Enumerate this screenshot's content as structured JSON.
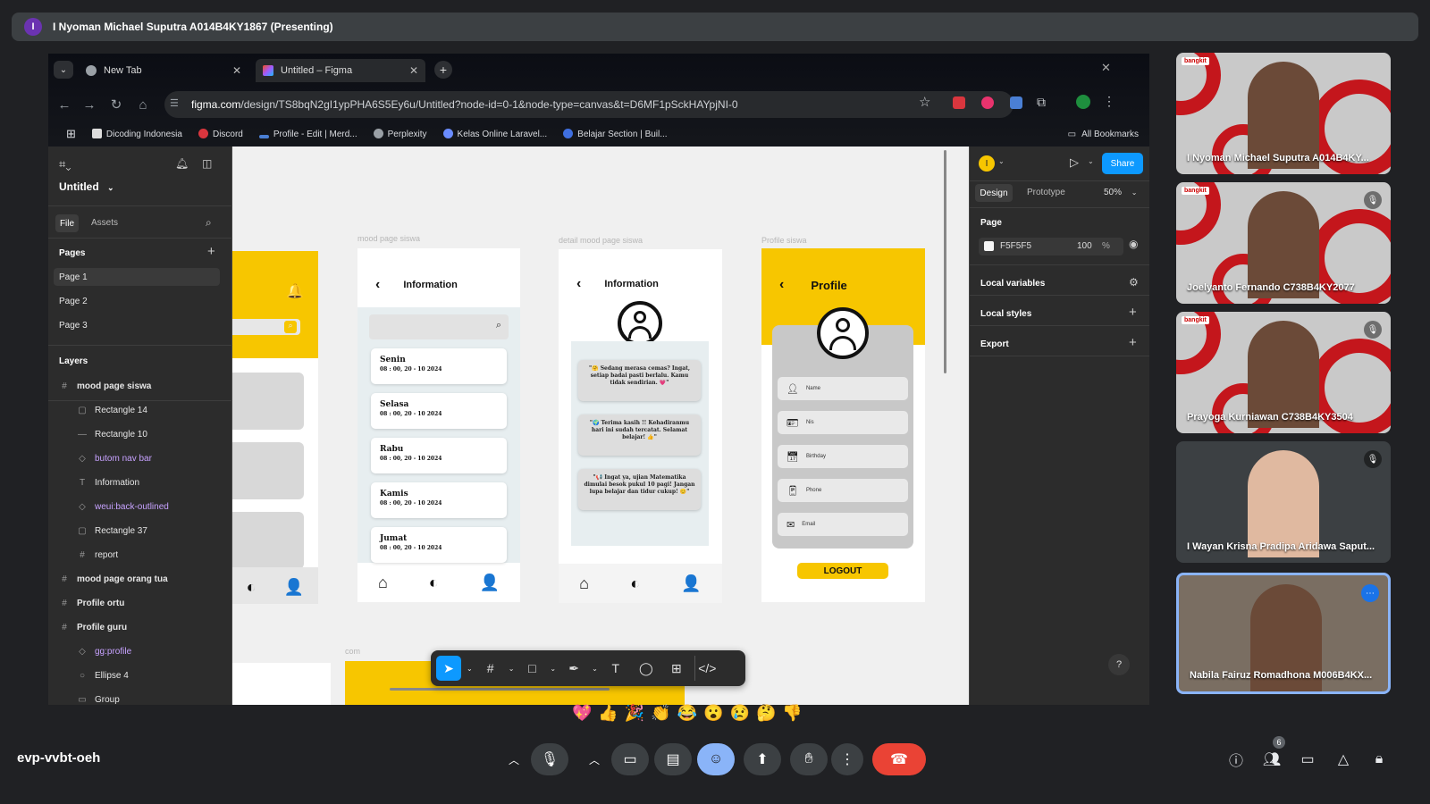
{
  "meet": {
    "presenting_initial": "I",
    "presenting_text": "I Nyoman Michael Suputra A014B4KY1867 (Presenting)",
    "meeting_code": "evp-vvbt-oeh",
    "participant_count": "6",
    "reactions": [
      "💖",
      "👍",
      "🎉",
      "👏",
      "😂",
      "😮",
      "😢",
      "🤔",
      "👎"
    ],
    "participants": [
      {
        "name": "I Nyoman Michael Suputra A014B4KY...",
        "muted": false,
        "brand": "bangkit"
      },
      {
        "name": "Joelyanto Fernando C738B4KY2077",
        "muted": true,
        "brand": "bangkit"
      },
      {
        "name": "Prayoga Kurniawan C738B4KY3504",
        "muted": true,
        "brand": "bangkit"
      },
      {
        "name": "I Wayan Krisna Pradipa Aridawa Saput...",
        "muted": true,
        "brand": ""
      },
      {
        "name": "Nabila Fairuz Romadhona M006B4KX...",
        "muted": false,
        "brand": ""
      }
    ]
  },
  "browser": {
    "tabs": [
      {
        "label": "New Tab",
        "active": false
      },
      {
        "label": "Untitled – Figma",
        "active": true
      }
    ],
    "url_host": "figma.com",
    "url_path": "/design/TS8bqN2gI1ypPHA6S5Ey6u/Untitled?node-id=0-1&node-type=canvas&t=D6MF1pSckHAYpjNI-0",
    "bookmarks": [
      "Dicoding Indonesia",
      "Discord",
      "Profile - Edit | Merd...",
      "Perplexity",
      "Kelas Online Laravel...",
      "Belajar Section | Buil..."
    ],
    "all_bookmarks": "All Bookmarks"
  },
  "figma": {
    "file_name": "Untitled",
    "left_tabs": [
      "File",
      "Assets"
    ],
    "pages_label": "Pages",
    "pages": [
      "Page 1",
      "Page 2",
      "Page 3"
    ],
    "layers_label": "Layers",
    "layers": [
      {
        "name": "mood page siswa",
        "type": "frame",
        "indent": 0
      },
      {
        "name": "Rectangle 14",
        "type": "rect",
        "indent": 1
      },
      {
        "name": "Rectangle 10",
        "type": "line",
        "indent": 1
      },
      {
        "name": "butom nav bar",
        "type": "component",
        "indent": 1
      },
      {
        "name": "Information",
        "type": "text",
        "indent": 1
      },
      {
        "name": "weui:back-outlined",
        "type": "component",
        "indent": 1
      },
      {
        "name": "Rectangle 37",
        "type": "rect",
        "indent": 1
      },
      {
        "name": "report",
        "type": "frame",
        "indent": 1
      },
      {
        "name": "mood page orang tua",
        "type": "frame",
        "indent": 0
      },
      {
        "name": "Profile ortu",
        "type": "frame",
        "indent": 0
      },
      {
        "name": "Profile guru",
        "type": "frame",
        "indent": 0
      },
      {
        "name": "gg:profile",
        "type": "component",
        "indent": 1
      },
      {
        "name": "Ellipse 4",
        "type": "ellipse",
        "indent": 1
      },
      {
        "name": "Group",
        "type": "group",
        "indent": 1
      }
    ],
    "right": {
      "avatar_initial": "I",
      "share": "Share",
      "tabs": [
        "Design",
        "Prototype"
      ],
      "zoom": "50%",
      "page_label": "Page",
      "page_color": "F5F5F5",
      "page_opacity": "100",
      "pct": "%",
      "sections": [
        "Local variables",
        "Local styles",
        "Export"
      ],
      "help": "?"
    },
    "canvas": {
      "frame_labels": [
        "mood page siswa",
        "detail mood page siswa",
        "Profile siswa",
        "com"
      ],
      "info_title": "Information",
      "days": [
        {
          "day": "Senin",
          "date": "08 : 00, 20 - 10 2024"
        },
        {
          "day": "Selasa",
          "date": "08 : 00, 20 - 10 2024"
        },
        {
          "day": "Rabu",
          "date": "08 : 00, 20 - 10 2024"
        },
        {
          "day": "Kamis",
          "date": "08 : 00, 20 - 10 2024"
        },
        {
          "day": "Jumat",
          "date": "08 : 00, 20 - 10 2024"
        }
      ],
      "messages": [
        "\"🤗 Sedang merasa cemas? Ingat, setiap badai pasti berlalu. Kamu tidak sendirian. 💗\"",
        "\"🌍 Terima kasih !! Kehadiranmu hari ini sudah tercatat. Selamat belajar! 👍\"",
        "\"📢 Ingat ya, ujian Matematika dimulai besok pukul 10 pagi! Jangan lupa belajar dan tidur cukup! 😊\""
      ],
      "profile_title": "Profile",
      "fields": [
        "Name",
        "Nis",
        "Birthday",
        "Phone",
        "Email"
      ],
      "logout": "LOGOUT"
    }
  }
}
